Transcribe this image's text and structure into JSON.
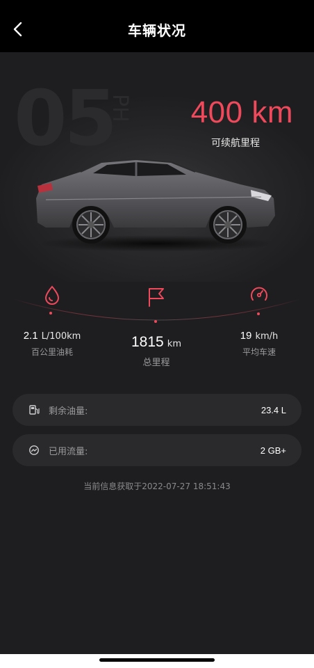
{
  "header": {
    "title": "车辆状况"
  },
  "hero": {
    "watermark": "05",
    "watermark_sub": "PH",
    "range_value": "400 km",
    "range_label": "可续航里程"
  },
  "stats": [
    {
      "value": "2.1",
      "unit": "L/100km",
      "label": "百公里油耗",
      "icon": "fuel-drop-icon"
    },
    {
      "value": "1815",
      "unit": "km",
      "label": "总里程",
      "icon": "flag-icon"
    },
    {
      "value": "19",
      "unit": "km/h",
      "label": "平均车速",
      "icon": "speedometer-icon"
    }
  ],
  "info_rows": [
    {
      "label": "剩余油量:",
      "value": "23.4 L",
      "icon": "fuel-pump-icon"
    },
    {
      "label": "已用流量:",
      "value": "2 GB+",
      "icon": "data-usage-icon"
    }
  ],
  "timestamp": "当前信息获取于2022-07-27 18:51:43",
  "colors": {
    "accent": "#f0495b",
    "background": "#1e1e20",
    "card": "#2a2a2c"
  }
}
